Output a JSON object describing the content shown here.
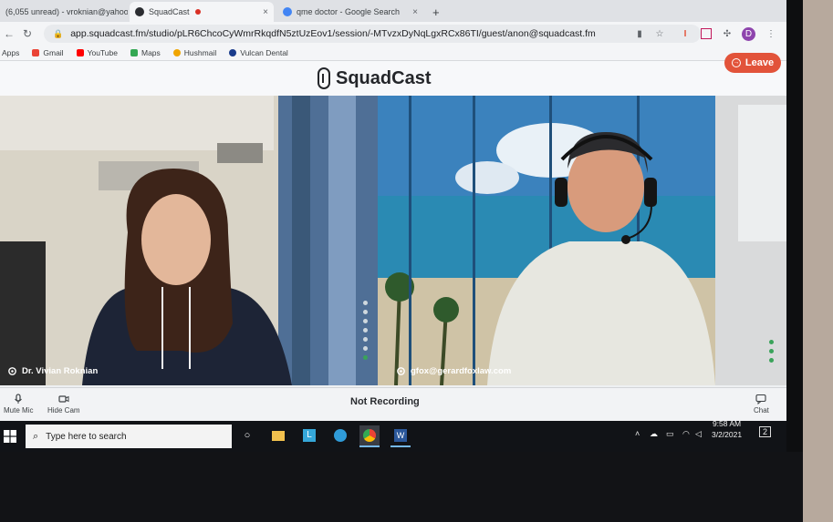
{
  "browser": {
    "tabs": [
      {
        "label": "(6,055 unread) - vroknian@yahoo",
        "close": "×"
      },
      {
        "label": "SquadCast",
        "close": "×"
      },
      {
        "label": "qme doctor - Google Search",
        "close": "×"
      }
    ],
    "url": "app.squadcast.fm/studio/pLR6ChcoCyWmrRkqdfN5ztUzEov1/session/-MTvzxDyNqLgxRCx86TI/guest/anon@squadcast.fm",
    "profile_initial": "D",
    "bookmarks": [
      "Apps",
      "Gmail",
      "YouTube",
      "Maps",
      "Hushmail",
      "Vulcan Dental"
    ]
  },
  "app": {
    "brand": {
      "part1": "Squad",
      "part2": "Cast"
    },
    "leave_label": "Leave",
    "participants": [
      {
        "name": "Dr. Vivian Roknian"
      },
      {
        "name": "gfox@gerardfoxlaw.com"
      }
    ],
    "controls": {
      "mute_label": "Mute Mic",
      "hidecam_label": "Hide Cam",
      "recording_status": "Not Recording",
      "chat_label": "Chat"
    }
  },
  "taskbar": {
    "search_placeholder": "Type here to search",
    "time": "9:58 AM",
    "date": "3/2/2021",
    "notification_count": "2"
  },
  "colors": {
    "accent": "#e2533a",
    "status_ok": "#3aa35a"
  }
}
